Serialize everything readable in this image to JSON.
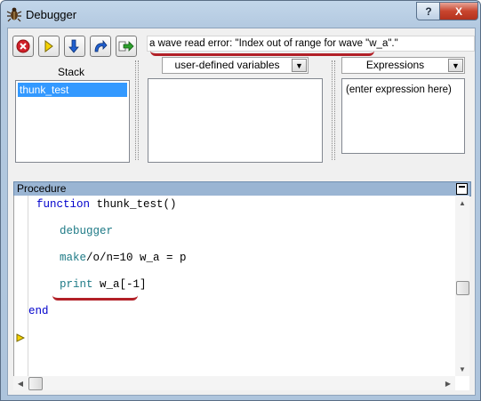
{
  "window": {
    "title": "Debugger",
    "help_label": "?",
    "close_label": "X"
  },
  "toolbar": {
    "buttons": [
      {
        "name": "stop-button",
        "icon": "stop-icon"
      },
      {
        "name": "go-button",
        "icon": "go-arrow-icon"
      },
      {
        "name": "step-into-button",
        "icon": "step-into-icon"
      },
      {
        "name": "step-over-button",
        "icon": "step-over-icon"
      },
      {
        "name": "step-out-button",
        "icon": "step-out-icon"
      }
    ],
    "error_message": "a wave read error: \"Index out of range for wave \"w_a\".\""
  },
  "stack": {
    "label": "Stack",
    "items": [
      "thunk_test"
    ],
    "selected_index": 0
  },
  "variables": {
    "dropdown_value": "user-defined variables"
  },
  "expressions": {
    "dropdown_value": "Expressions",
    "placeholder_line": "(enter expression here)"
  },
  "procedure": {
    "title": "Procedure",
    "lines": [
      {
        "kw": "function",
        "rest": " thunk_test()"
      },
      {
        "kw": "debugger",
        "rest": ""
      },
      {
        "kw": "make",
        "rest": "/o/n=10 w_a = p"
      },
      {
        "kw": "print",
        "rest": " w_a[-1]"
      },
      {
        "kw": "end",
        "rest": ""
      }
    ]
  },
  "colors": {
    "annotation": "#b22027",
    "selection": "#3399ff",
    "keyword_blue": "#0000cc",
    "keyword_teal": "#1e7a86"
  }
}
